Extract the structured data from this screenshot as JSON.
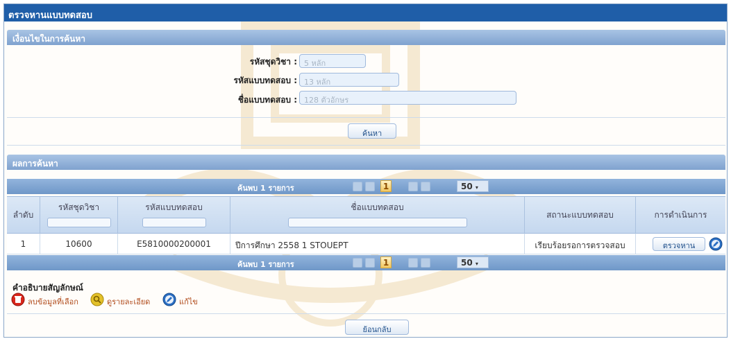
{
  "window_title": "ตรวจหานแบบทดสอบ",
  "search_section": {
    "title": "เงื่อนไขในการค้นหา",
    "fields": [
      {
        "label": "รหัสชุดวิชา :",
        "placeholder": "5 หลัก"
      },
      {
        "label": "รหัสแบบทดสอบ :",
        "placeholder": "13 หลัก"
      },
      {
        "label": "ชื่อแบบทดสอบ :",
        "placeholder": "128 ตัวอักษร"
      }
    ],
    "search_button": "ค้นหา"
  },
  "results_section": {
    "title": "ผลการค้นหา",
    "pager": {
      "found_text": "ค้นพบ 1 รายการ",
      "current_page": "1",
      "page_size": "50"
    },
    "columns": [
      "ลำดับ",
      "รหัสชุดวิชา",
      "รหัสแบบทดสอบ",
      "ชื่อแบบทดสอบ",
      "สถานะแบบทดสอบ",
      "การดำเนินการ"
    ],
    "rows": [
      {
        "no": "1",
        "course_code": "10600",
        "test_code": "E5810000200001",
        "test_name": "ปีการศึกษา 2558 1 STOUEPT",
        "status": "เรียบร้อยรอการตรวจสอบ",
        "action_label": "ตรวจหาน"
      }
    ]
  },
  "legend": {
    "title": "คำอธิบายสัญลักษณ์",
    "items": [
      {
        "icon": "delete-icon",
        "label": "ลบข้อมูลที่เลือก",
        "color": "#d9261c"
      },
      {
        "icon": "view-details-icon",
        "label": "ดูรายละเอียด",
        "color": "#e3c12a"
      },
      {
        "icon": "edit-icon",
        "label": "แก้ไข",
        "color": "#2b6fc4"
      }
    ]
  },
  "back_button": "ย้อนกลับ",
  "colors": {
    "title_bar": "#1f5ea8",
    "section_bar": "#8fb0d8",
    "pager_bar": "#7fa3d0",
    "legend_text": "#b04a1a"
  }
}
